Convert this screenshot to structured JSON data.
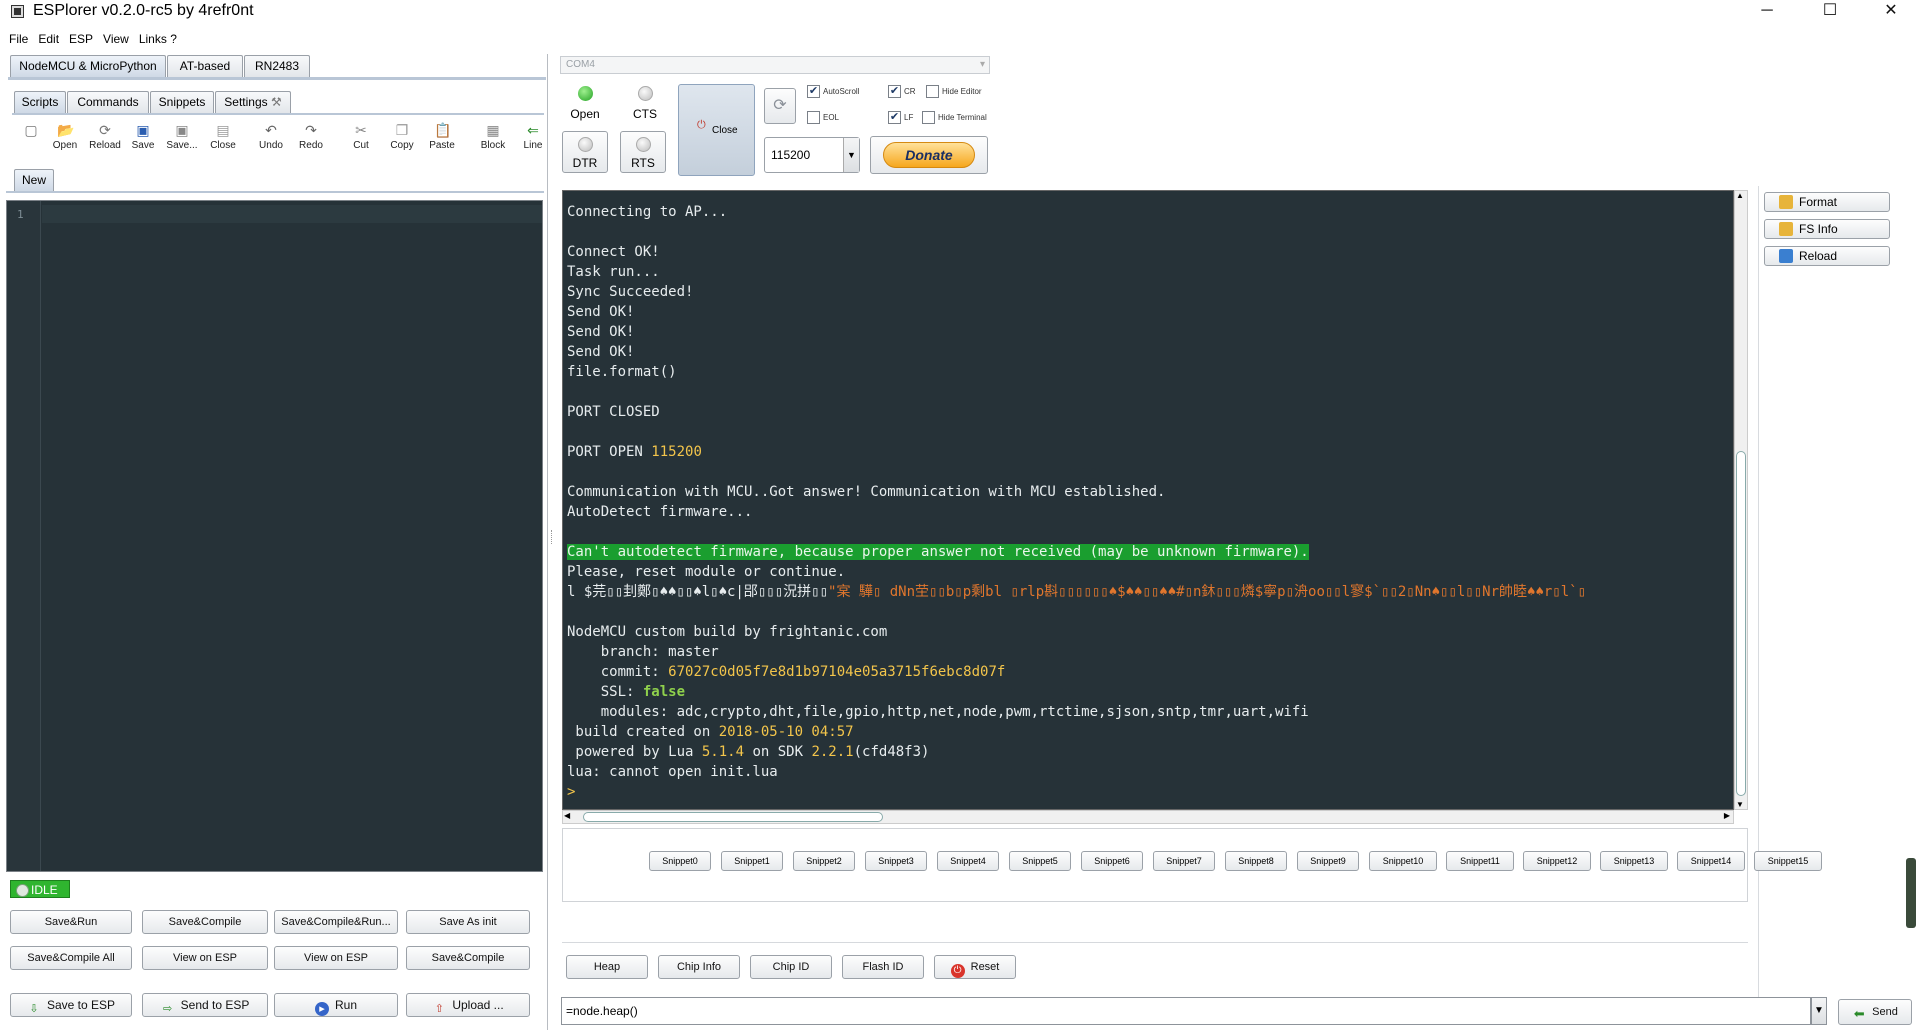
{
  "window": {
    "title": "ESPlorer v0.2.0-rc5 by 4refr0nt",
    "minimize": "─",
    "maximize": "☐",
    "close": "✕"
  },
  "menu": [
    "File",
    "Edit",
    "ESP",
    "View",
    "Links ?"
  ],
  "main_tabs": [
    "NodeMCU & MicroPython",
    "AT-based",
    "RN2483"
  ],
  "sub_tabs": [
    "Scripts",
    "Commands",
    "Snippets",
    "Settings"
  ],
  "toolbar": [
    {
      "label": "",
      "icon": "new-file-icon",
      "glyph": "▢",
      "color": "#777"
    },
    {
      "label": "Open",
      "icon": "folder-icon",
      "glyph": "📂",
      "color": "#d99a1c"
    },
    {
      "label": "Reload",
      "icon": "reload-icon",
      "glyph": "⟳",
      "color": "#777"
    },
    {
      "label": "Save",
      "icon": "floppy-icon",
      "glyph": "▣",
      "color": "#2a5db0"
    },
    {
      "label": "Save...",
      "icon": "floppy-icon",
      "glyph": "▣",
      "color": "#888"
    },
    {
      "label": "Close",
      "icon": "close-file-icon",
      "glyph": "▤",
      "color": "#999"
    },
    {
      "label": "Undo",
      "icon": "undo-icon",
      "glyph": "↶",
      "color": "#666"
    },
    {
      "label": "Redo",
      "icon": "redo-icon",
      "glyph": "↷",
      "color": "#666"
    },
    {
      "label": "Cut",
      "icon": "scissors-icon",
      "glyph": "✂",
      "color": "#888"
    },
    {
      "label": "Copy",
      "icon": "copy-icon",
      "glyph": "❐",
      "color": "#999"
    },
    {
      "label": "Paste",
      "icon": "paste-icon",
      "glyph": "📋",
      "color": "#c48a2a"
    },
    {
      "label": "Block",
      "icon": "block-icon",
      "glyph": "▦",
      "color": "#888"
    },
    {
      "label": "Line",
      "icon": "line-icon",
      "glyph": "⇐",
      "color": "#2a8a2a"
    }
  ],
  "file_tab": "New",
  "editor": {
    "line_number": "1"
  },
  "status": "IDLE",
  "left_buttons": [
    [
      "Save&Run",
      "Save&Compile",
      "Save&Compile&Run...",
      "Save As init"
    ],
    [
      "Save&Compile All",
      "View on ESP",
      "View on ESP",
      "Save&Compile"
    ]
  ],
  "left_bottom_buttons": [
    "Save to ESP",
    "Send to ESP",
    "Run",
    "Upload ..."
  ],
  "port": {
    "selected": "COM4",
    "open_label": "Open",
    "cts_label": "CTS",
    "dtr_label": "DTR",
    "rts_label": "RTS",
    "close_label": "Close",
    "baud": "115200",
    "donate": "Donate"
  },
  "checkboxes": [
    {
      "label": "AutoScroll",
      "checked": true
    },
    {
      "label": "CR",
      "checked": true
    },
    {
      "label": "Hide Editor",
      "checked": false
    },
    {
      "label": "EOL",
      "checked": false
    },
    {
      "label": "LF",
      "checked": true
    },
    {
      "label": "Hide Terminal",
      "checked": false
    }
  ],
  "terminal": {
    "lines": [
      {
        "text": "Connecting to AP..."
      },
      {
        "text": ""
      },
      {
        "text": "Connect OK!"
      },
      {
        "text": "Task run..."
      },
      {
        "text": "Sync Succeeded!"
      },
      {
        "text": "Send OK!"
      },
      {
        "text": "Send OK!"
      },
      {
        "text": "Send OK!"
      },
      {
        "text": "file.format()"
      },
      {
        "text": ""
      },
      {
        "text": "PORT CLOSED"
      },
      {
        "text": ""
      },
      {
        "parts": [
          {
            "t": "PORT OPEN "
          },
          {
            "t": "115200",
            "c": "y"
          }
        ]
      },
      {
        "text": ""
      },
      {
        "text": "Communication with MCU..Got answer! Communication with MCU established."
      },
      {
        "text": "AutoDetect firmware..."
      },
      {
        "text": ""
      },
      {
        "parts": [
          {
            "t": "Can",
            "c": "hl"
          },
          {
            "t": "'t autodetect firmware, because proper answer not received (may be unknown firmware).",
            "c": "hl"
          }
        ]
      },
      {
        "text": "Please, reset module or continue."
      },
      {
        "parts": [
          {
            "t": "l $芫▯▯刲鄭▯♠♠▯▯♠l▯♠c|郘▯▯▯況拼▯▯"
          },
          {
            "t": "\"宲 驊▯ dNn茔▯▯b▯p剩bl ▯rlp斟▯▯▯▯▯▯♠$♠♠▯▯♠♠#▯n鈢▯▯▯燐$寧p▯洀oo▯▯l寥$`▯▯2▯Nn♠▯▯l▯▯Nr帥睦♠♠r▯l`▯",
            "c": "o"
          }
        ]
      },
      {
        "text": ""
      },
      {
        "text": "NodeMCU custom build by frightanic.com"
      },
      {
        "text": "    branch: master"
      },
      {
        "parts": [
          {
            "t": "    commit: "
          },
          {
            "t": "67027c0d05f7e8d1b97104e05a3715f6ebc8d07f",
            "c": "y"
          }
        ]
      },
      {
        "parts": [
          {
            "t": "    SSL: "
          },
          {
            "t": "false",
            "c": "g"
          }
        ]
      },
      {
        "text": "    modules: adc,crypto,dht,file,gpio,http,net,node,pwm,rtctime,sjson,sntp,tmr,uart,wifi"
      },
      {
        "parts": [
          {
            "t": " build created on "
          },
          {
            "t": "2018-05-10 04:57",
            "c": "y"
          }
        ]
      },
      {
        "parts": [
          {
            "t": " powered by Lua "
          },
          {
            "t": "5.1.4",
            "c": "y"
          },
          {
            "t": " on SDK "
          },
          {
            "t": "2.2.1",
            "c": "y"
          },
          {
            "t": "(cfd48f3)"
          }
        ]
      },
      {
        "text": "lua: cannot open init.lua"
      },
      {
        "parts": [
          {
            "t": ">",
            "c": "y"
          }
        ]
      }
    ]
  },
  "right_buttons": [
    {
      "label": "Format",
      "icon": "format-icon",
      "color": "#e7b43a"
    },
    {
      "label": "FS Info",
      "icon": "fs-info-icon",
      "color": "#e7b43a"
    },
    {
      "label": "Reload",
      "icon": "reload-icon",
      "color": "#3a7fd0"
    }
  ],
  "snippets": [
    "Snippet0",
    "Snippet1",
    "Snippet2",
    "Snippet3",
    "Snippet4",
    "Snippet5",
    "Snippet6",
    "Snippet7",
    "Snippet8",
    "Snippet9",
    "Snippet10",
    "Snippet11",
    "Snippet12",
    "Snippet13",
    "Snippet14",
    "Snippet15"
  ],
  "info_buttons": [
    "Heap",
    "Chip Info",
    "Chip ID",
    "Flash ID",
    "Reset"
  ],
  "command": {
    "value": "=node.heap()",
    "send": "Send"
  }
}
